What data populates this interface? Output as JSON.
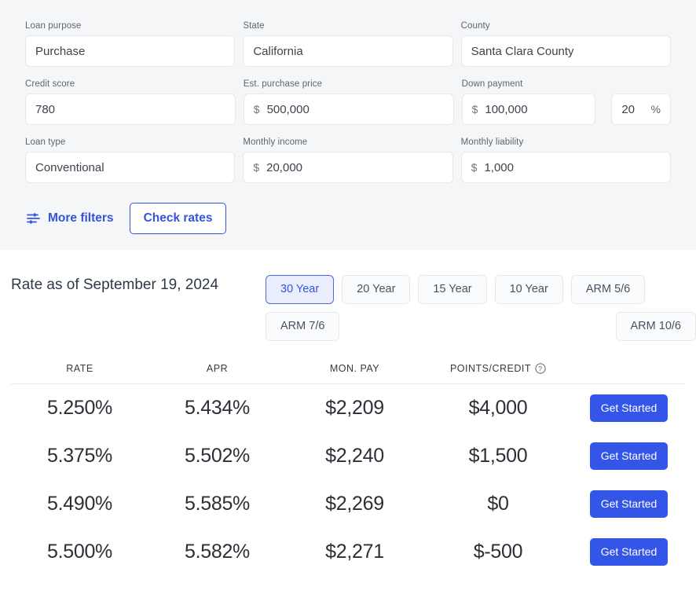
{
  "form": {
    "fields": [
      [
        {
          "label": "Loan purpose",
          "value": "Purchase",
          "prefix": "",
          "name": "loan-purpose"
        },
        {
          "label": "State",
          "value": "California",
          "prefix": "",
          "name": "state"
        },
        {
          "label": "County",
          "value": "Santa Clara County",
          "prefix": "",
          "name": "county"
        }
      ],
      [
        {
          "label": "Credit score",
          "value": "780",
          "prefix": "",
          "name": "credit-score"
        },
        {
          "label": "Est. purchase price",
          "value": "500,000",
          "prefix": "$",
          "name": "est-purchase-price"
        },
        {
          "label": "Down payment",
          "value": "100,000",
          "prefix": "$",
          "name": "down-payment"
        }
      ],
      [
        {
          "label": "Loan type",
          "value": "Conventional",
          "prefix": "",
          "name": "loan-type"
        },
        {
          "label": "Monthly income",
          "value": "20,000",
          "prefix": "$",
          "name": "monthly-income"
        },
        {
          "label": "Monthly liability",
          "value": "1,000",
          "prefix": "$",
          "name": "monthly-liability"
        }
      ]
    ],
    "down_payment_percent": {
      "value": "20",
      "unit": "%"
    },
    "more_filters_label": "More filters",
    "check_rates_label": "Check rates",
    "more_filters_icon": "sliders-icon"
  },
  "rates": {
    "as_of_label": "Rate as of September 19, 2024",
    "terms": [
      {
        "label": "30 Year",
        "selected": true
      },
      {
        "label": "20 Year",
        "selected": false
      },
      {
        "label": "15 Year",
        "selected": false
      },
      {
        "label": "10 Year",
        "selected": false
      },
      {
        "label": "ARM 5/6",
        "selected": false
      },
      {
        "label": "ARM 7/6",
        "selected": false
      },
      {
        "label": "ARM 10/6",
        "selected": false
      }
    ],
    "columns": {
      "rate": "RATE",
      "apr": "APR",
      "monthly_payment": "MON. PAY",
      "points_credit": "POINTS/CREDIT",
      "points_help_icon": "help-circle-icon"
    },
    "cta_label": "Get Started",
    "rows": [
      {
        "rate": "5.250%",
        "apr": "5.434%",
        "mon_pay": "$2,209",
        "points_credit": "$4,000"
      },
      {
        "rate": "5.375%",
        "apr": "5.502%",
        "mon_pay": "$2,240",
        "points_credit": "$1,500"
      },
      {
        "rate": "5.490%",
        "apr": "5.585%",
        "mon_pay": "$2,269",
        "points_credit": "$0"
      },
      {
        "rate": "5.500%",
        "apr": "5.582%",
        "mon_pay": "$2,271",
        "points_credit": "$-500"
      }
    ]
  },
  "colors": {
    "accent_blue": "#3355e8",
    "link_blue": "#3355dd",
    "panel_bg": "#f5f6f7",
    "selected_tab_bg": "#eaeefc"
  }
}
